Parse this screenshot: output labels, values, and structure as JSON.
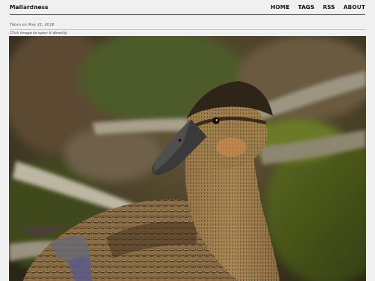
{
  "site": {
    "title": "Mallardness"
  },
  "nav": {
    "items": [
      {
        "label": "HOME"
      },
      {
        "label": "TAGS"
      },
      {
        "label": "RSS"
      },
      {
        "label": "ABOUT"
      }
    ]
  },
  "post": {
    "taken_on": "Taken on May 21, 2018",
    "caption": "Click image to open it directly."
  },
  "colors": {
    "background": "#f0f0f0",
    "text": "#111111",
    "muted": "#555555"
  }
}
